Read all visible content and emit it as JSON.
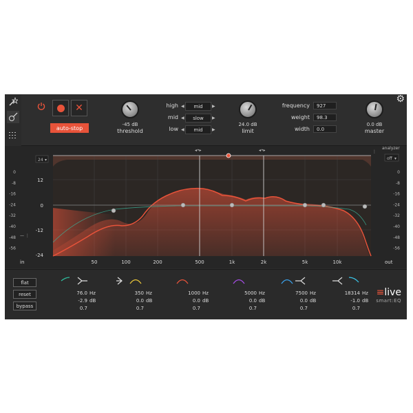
{
  "top": {
    "auto_stop_label": "auto-stop",
    "threshold_value": "-45 dB",
    "threshold_label": "threshold",
    "limit_value": "24.0 dB",
    "limit_label": "limit",
    "master_value": "0.0 dB",
    "master_label": "master",
    "rows": [
      {
        "label": "high",
        "value": "mid"
      },
      {
        "label": "mid",
        "value": "slow"
      },
      {
        "label": "low",
        "value": "mid"
      }
    ],
    "fields": [
      {
        "label": "frequency",
        "value": "927"
      },
      {
        "label": "weight",
        "value": "98.3"
      },
      {
        "label": "width",
        "value": "0.0"
      }
    ]
  },
  "eq": {
    "range_value": "24",
    "analyzer_label": "analyzer",
    "analyzer_value": "off",
    "db_labels": [
      "12",
      "0",
      "-12",
      "-24"
    ],
    "freq_labels": [
      "in",
      "50",
      "100",
      "200",
      "500",
      "1k",
      "2k",
      "5k",
      "10k",
      "out"
    ],
    "meter_left": [
      "0",
      "-8",
      "-16",
      "-24",
      "-32",
      "-40",
      "-48",
      "-56"
    ],
    "meter_right": [
      "0",
      "-8",
      "-16",
      "-24",
      "-32",
      "-40",
      "-48",
      "-56"
    ]
  },
  "bottom": {
    "flat_label": "flat",
    "reset_label": "reset",
    "bypass_label": "bypass",
    "bands": [
      {
        "freq": "76.0",
        "gain": "-2.9",
        "q": "0.7",
        "color": "#2fc0a0"
      },
      {
        "freq": "350",
        "gain": "0.0",
        "q": "0.7",
        "color": "#e8c53a"
      },
      {
        "freq": "1000",
        "gain": "0.0",
        "q": "0.7",
        "color": "#e8533a"
      },
      {
        "freq": "5000",
        "gain": "0.0",
        "q": "0.7",
        "color": "#a24ce0"
      },
      {
        "freq": "7500",
        "gain": "0.0",
        "q": "0.7",
        "color": "#3a9fe8"
      },
      {
        "freq": "18314",
        "gain": "-1.0",
        "q": "0.7",
        "color": "#3ac5e8"
      }
    ],
    "hz_unit": "Hz",
    "db_unit": "dB",
    "logo_main_a": "≡",
    "logo_main_b": "live",
    "logo_sub": "smart:EQ"
  },
  "colors": {
    "accent": "#e8533a",
    "background": "#2b2b2b"
  }
}
